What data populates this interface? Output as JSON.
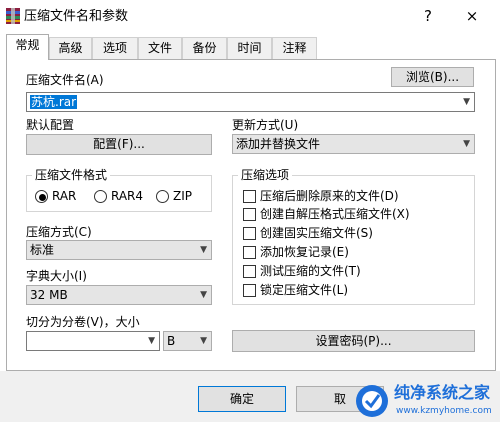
{
  "window": {
    "title": "压缩文件名和参数",
    "help_label": "?",
    "close_label": "×"
  },
  "tabs": [
    {
      "label": "常规",
      "active": true
    },
    {
      "label": "高级"
    },
    {
      "label": "选项"
    },
    {
      "label": "文件"
    },
    {
      "label": "备份"
    },
    {
      "label": "时间"
    },
    {
      "label": "注释"
    }
  ],
  "general": {
    "archive_name_label": "压缩文件名(A)",
    "browse_button": "浏览(B)...",
    "archive_name_value": "苏杭.rar",
    "default_profile_label": "默认配置",
    "profile_button": "配置(F)...",
    "update_mode_label": "更新方式(U)",
    "update_mode_value": "添加并替换文件",
    "archive_format": {
      "title": "压缩文件格式",
      "options": [
        "RAR",
        "RAR4",
        "ZIP"
      ],
      "selected": "RAR"
    },
    "compression_method_label": "压缩方式(C)",
    "compression_method_value": "标准",
    "dictionary_size_label": "字典大小(I)",
    "dictionary_size_value": "32 MB",
    "split_label": "切分为分卷(V)，大小",
    "split_value": "",
    "split_unit": "B",
    "archive_options": {
      "title": "压缩选项",
      "items": [
        {
          "label": "压缩后删除原来的文件(D)",
          "checked": false
        },
        {
          "label": "创建自解压格式压缩文件(X)",
          "checked": false
        },
        {
          "label": "创建固实压缩文件(S)",
          "checked": false
        },
        {
          "label": "添加恢复记录(E)",
          "checked": false
        },
        {
          "label": "测试压缩的文件(T)",
          "checked": false
        },
        {
          "label": "锁定压缩文件(L)",
          "checked": false
        }
      ]
    },
    "set_password_button": "设置密码(P)..."
  },
  "footer": {
    "ok_button": "确定",
    "cancel_button": "取"
  },
  "watermark": {
    "title": "纯净系统之家",
    "url": "www.kzmyhome.com"
  },
  "colors": {
    "selection": "#0078d7",
    "button_face": "#e1e1e1",
    "watermark_blue": "#1e6fd9"
  }
}
